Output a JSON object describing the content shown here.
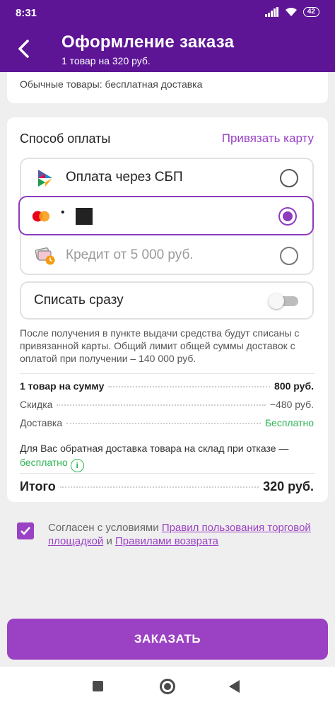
{
  "status_bar": {
    "time": "8:31",
    "battery": "42"
  },
  "header": {
    "title": "Оформление заказа",
    "subtitle": "1 товар на 320 руб."
  },
  "delivery_note": "Обычные товары: бесплатная доставка",
  "payment": {
    "title": "Способ оплаты",
    "link_card": "Привязать карту",
    "methods": [
      {
        "label": "Оплата через СБП",
        "icon": "sbp-icon",
        "selected": false
      },
      {
        "label": "•",
        "icon": "mastercard-icon",
        "selected": true
      },
      {
        "label": "Кредит от 5 000 руб.",
        "icon": "credit-card-clock-icon",
        "selected": false
      }
    ],
    "charge_now": {
      "label": "Списать сразу",
      "enabled": false
    }
  },
  "note": "После получения в пункте выдачи средства будут списаны с привязанной карты. Общий лимит общей суммы доставок с оплатой при получении – 140 000 руб.",
  "summary": {
    "rows": [
      {
        "label": "1 товар на сумму",
        "value": "800 руб."
      },
      {
        "label": "Скидка",
        "value": "−480 руб."
      },
      {
        "label": "Доставка",
        "value": "Бесплатно"
      }
    ],
    "return_note_prefix": "Для Вас обратная доставка товара на склад при отказе —",
    "return_note_value": "бесплатно",
    "total_label": "Итого",
    "total_value": "320 руб."
  },
  "agreement": {
    "checked": true,
    "text_1": "Согласен с условиями",
    "link_1": "Правил пользования торговой площадкой",
    "text_2": "и",
    "link_2": "Правилами возврата"
  },
  "order_button": "ЗАКАЗАТЬ",
  "colors": {
    "header": "#5d1596",
    "accent": "#9b42c4",
    "success": "#2eb455"
  }
}
